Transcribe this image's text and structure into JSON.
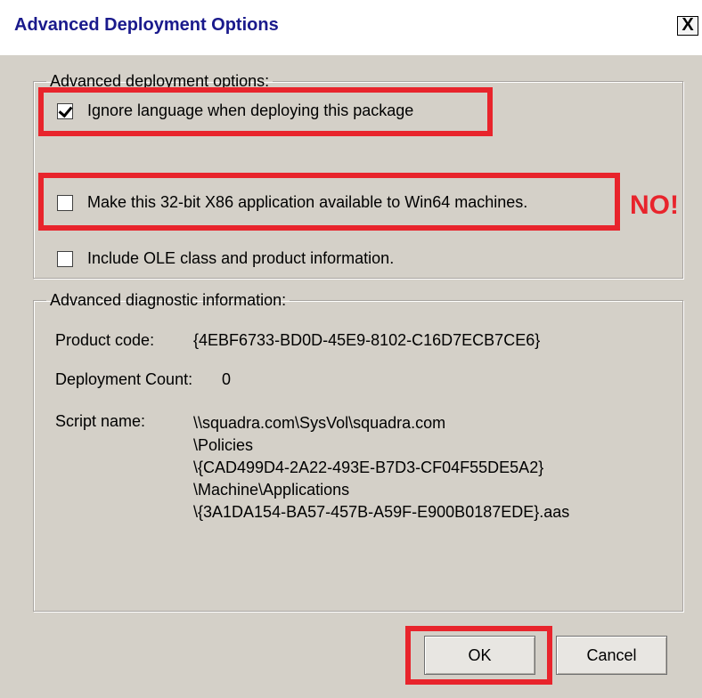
{
  "window": {
    "title": "Advanced Deployment Options",
    "close_glyph": "X"
  },
  "deployment_group": {
    "legend": "Advanced deployment options:",
    "options": [
      {
        "label": "Ignore language when deploying this package",
        "checked": true
      },
      {
        "label": "Make this 32-bit X86 application available to Win64 machines.",
        "checked": false
      },
      {
        "label": "Include OLE class and product information.",
        "checked": false
      }
    ]
  },
  "annotation": {
    "no_text": "NO!",
    "highlight_color": "#e8242c"
  },
  "diagnostic_group": {
    "legend": "Advanced diagnostic information:",
    "product_code_label": "Product code:",
    "product_code_value": "{4EBF6733-BD0D-45E9-8102-C16D7ECB7CE6}",
    "deployment_count_label": "Deployment Count:",
    "deployment_count_value": "0",
    "script_name_label": "Script name:",
    "script_name_lines": [
      "\\\\squadra.com\\SysVol\\squadra.com",
      "\\Policies",
      "\\{CAD499D4-2A22-493E-B7D3-CF04F55DE5A2}",
      "\\Machine\\Applications",
      "\\{3A1DA154-BA57-457B-A59F-E900B0187EDE}.aas"
    ]
  },
  "buttons": {
    "ok": "OK",
    "cancel": "Cancel"
  }
}
